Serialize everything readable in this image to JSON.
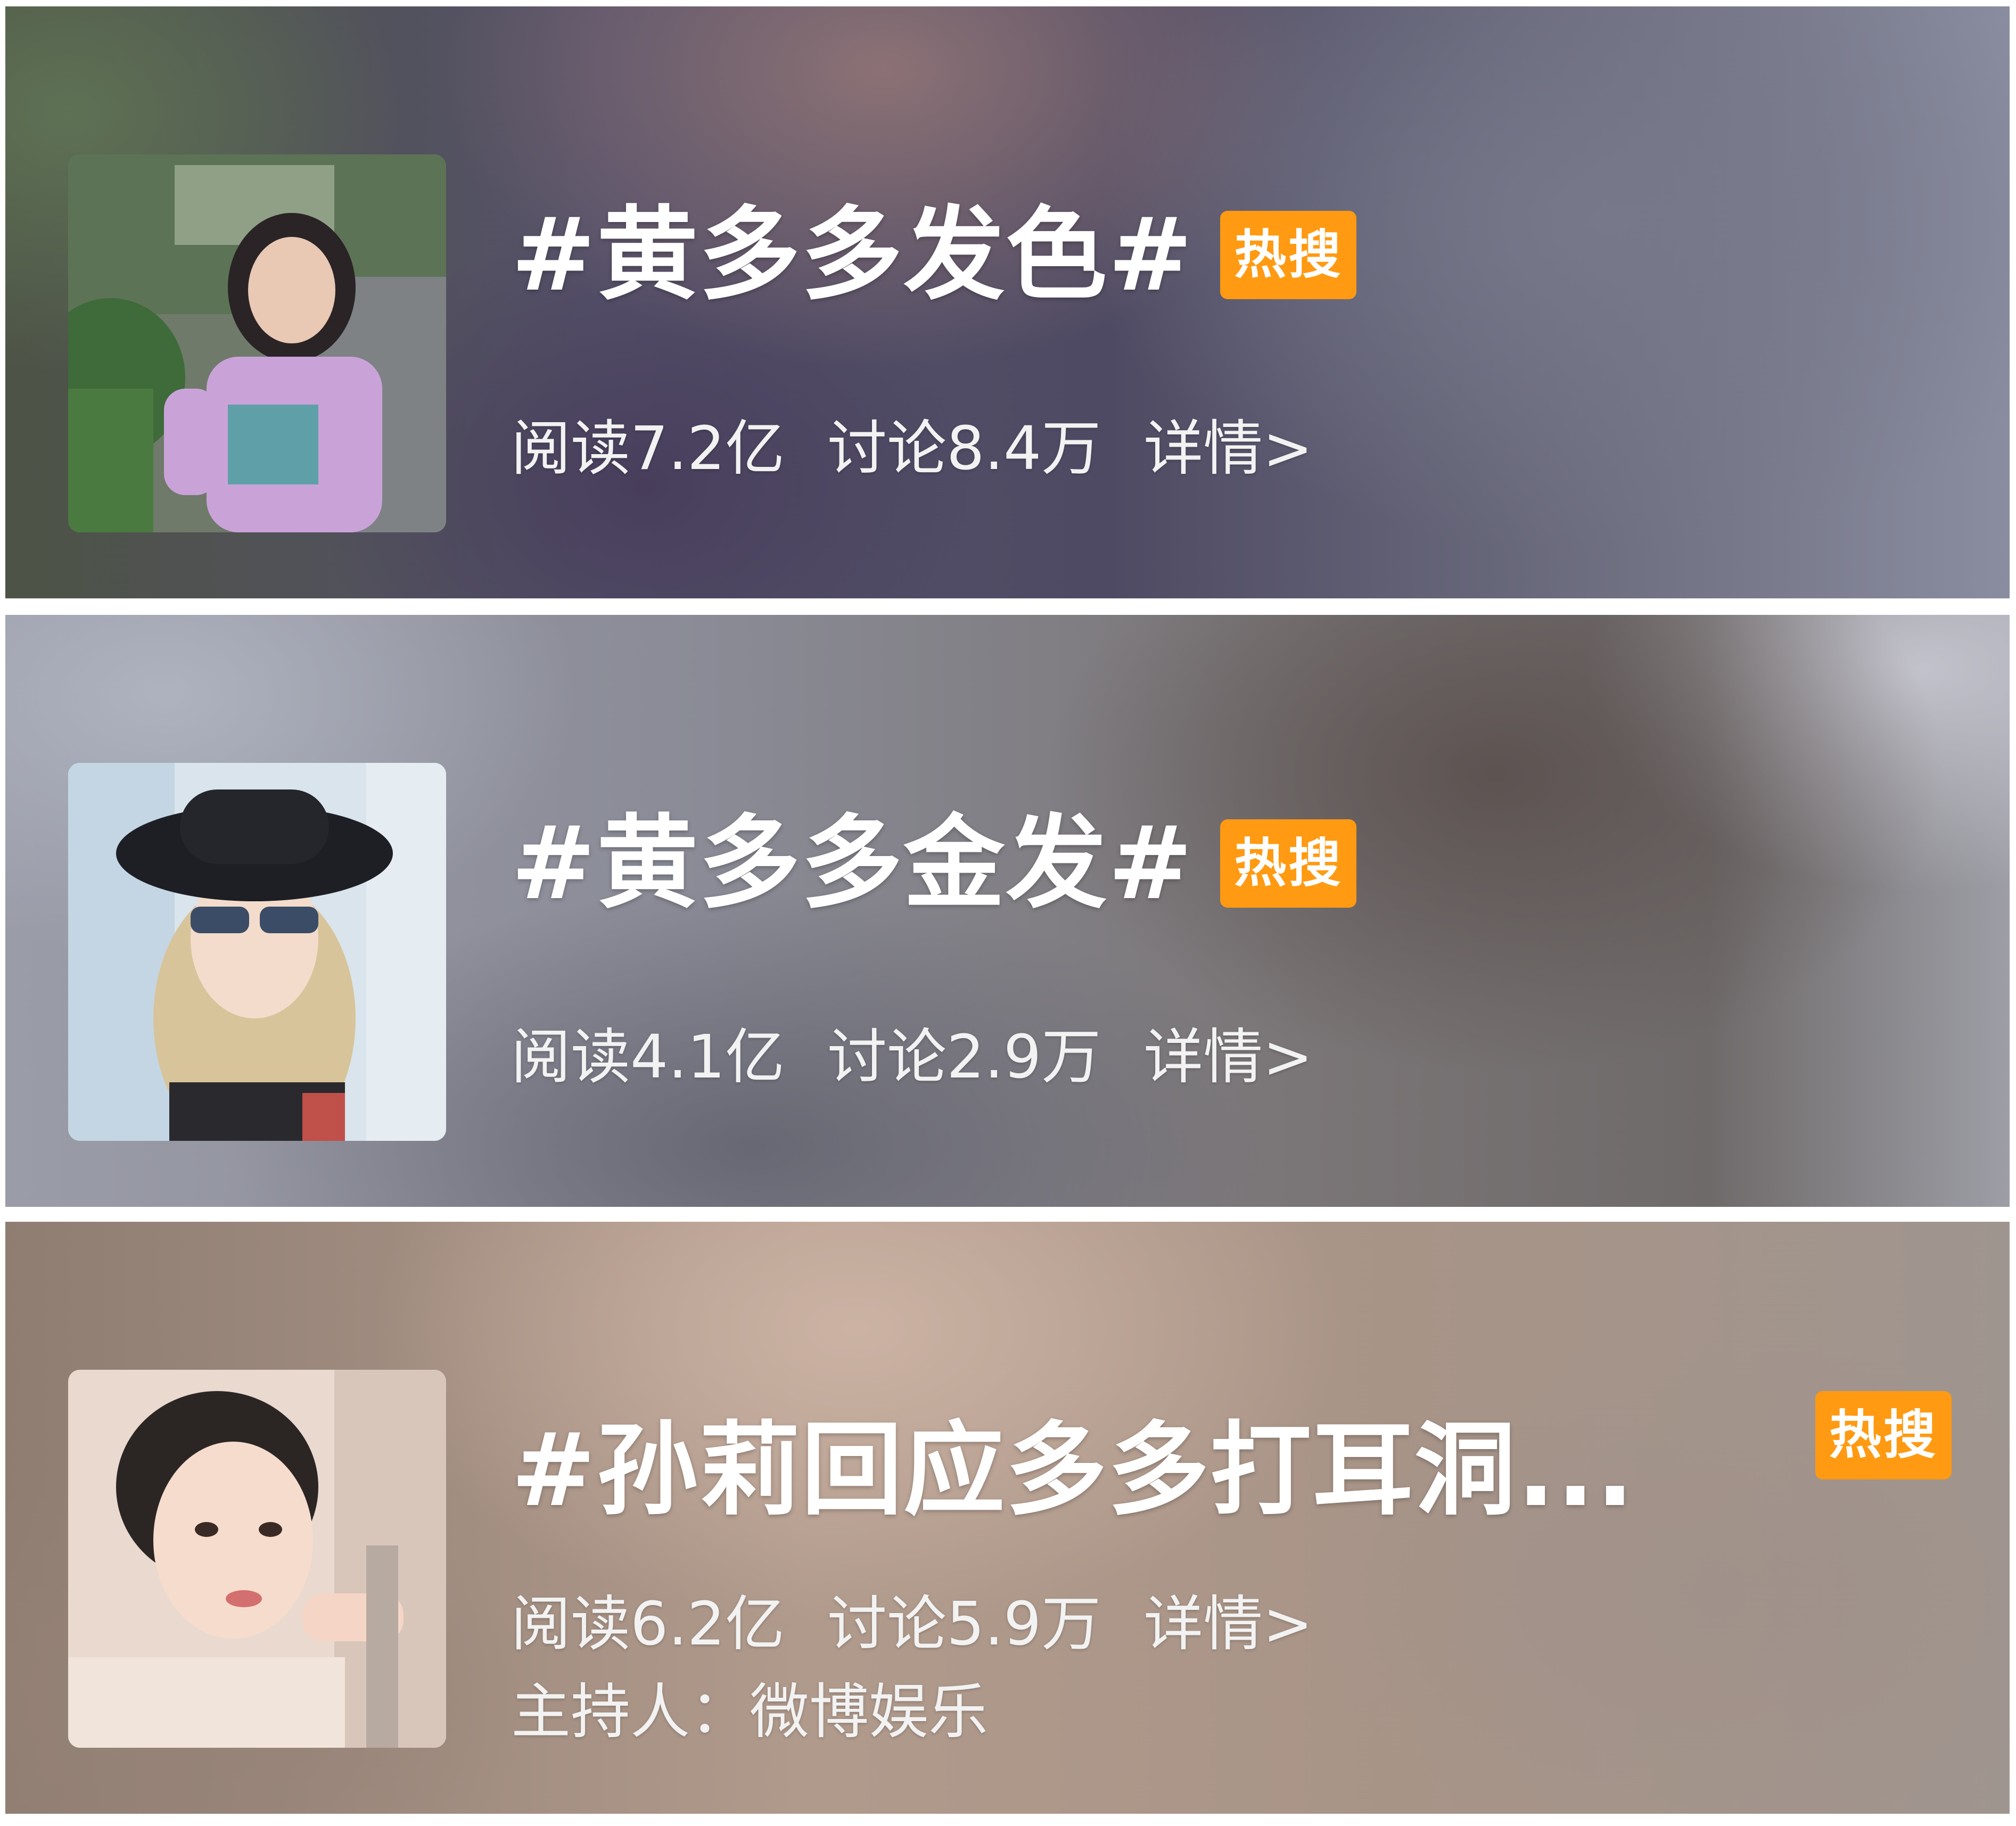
{
  "topics": [
    {
      "title": "#黄多多发色#",
      "badge": "热搜",
      "read_label": "阅读",
      "read_value": "7.2亿",
      "discuss_label": "讨论",
      "discuss_value": "8.4万",
      "details_label": "详情>",
      "thumbnail_icon": "girl-pink-shirt-photo"
    },
    {
      "title": "#黄多多金发#",
      "badge": "热搜",
      "read_label": "阅读",
      "read_value": "4.1亿",
      "discuss_label": "讨论",
      "discuss_value": "2.9万",
      "details_label": "详情>",
      "thumbnail_icon": "girl-hat-sunglasses-photo"
    },
    {
      "title": "#孙莉回应多多打耳洞...",
      "badge": "热搜",
      "read_label": "阅读",
      "read_value": "6.2亿",
      "discuss_label": "讨论",
      "discuss_value": "5.9万",
      "details_label": "详情>",
      "host_label": "主持人：",
      "host_value": "微博娱乐",
      "thumbnail_icon": "girl-portrait-photo"
    }
  ],
  "colors": {
    "badge": "#ff9a12",
    "title": "#ffffff"
  }
}
